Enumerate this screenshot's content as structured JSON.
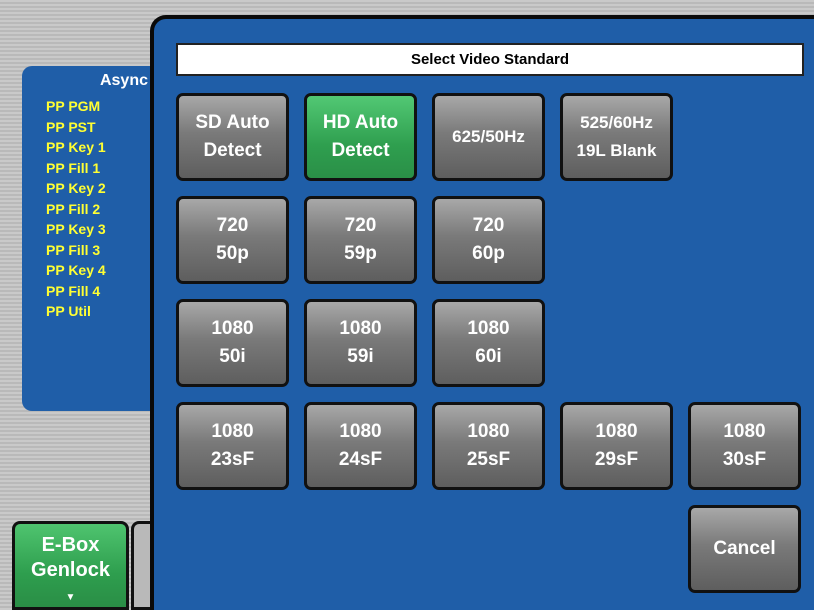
{
  "side_panel": {
    "title": "Async",
    "items": [
      "PP PGM",
      "PP PST",
      "PP Key 1",
      "PP Fill 1",
      "PP Key 2",
      "PP Fill 2",
      "PP Key 3",
      "PP Fill 3",
      "PP Key 4",
      "PP Fill 4",
      "PP Util"
    ]
  },
  "bottom_button": {
    "line1": "E-Box",
    "line2": "Genlock",
    "arrow": "▼"
  },
  "dialog": {
    "title": "Select Video Standard",
    "selected": "HD Auto Detect",
    "buttons": {
      "sd_auto": {
        "line1": "SD Auto",
        "line2": "Detect"
      },
      "hd_auto": {
        "line1": "HD Auto",
        "line2": "Detect"
      },
      "p625": {
        "line1": "625/50Hz"
      },
      "p525": {
        "line1": "525/60Hz",
        "line2": "19L Blank"
      },
      "p720_50": {
        "line1": "720",
        "line2": "50p"
      },
      "p720_59": {
        "line1": "720",
        "line2": "59p"
      },
      "p720_60": {
        "line1": "720",
        "line2": "60p"
      },
      "i1080_50": {
        "line1": "1080",
        "line2": "50i"
      },
      "i1080_59": {
        "line1": "1080",
        "line2": "59i"
      },
      "i1080_60": {
        "line1": "1080",
        "line2": "60i"
      },
      "sf1080_23": {
        "line1": "1080",
        "line2": "23sF"
      },
      "sf1080_24": {
        "line1": "1080",
        "line2": "24sF"
      },
      "sf1080_25": {
        "line1": "1080",
        "line2": "25sF"
      },
      "sf1080_29": {
        "line1": "1080",
        "line2": "29sF"
      },
      "sf1080_30": {
        "line1": "1080",
        "line2": "30sF"
      },
      "cancel": {
        "line1": "Cancel"
      }
    }
  },
  "colors": {
    "panel_blue": "#1f5ea8",
    "selected_green": "#3fae5e",
    "button_gray": "#7a7a7a",
    "list_yellow": "#ffff33"
  }
}
